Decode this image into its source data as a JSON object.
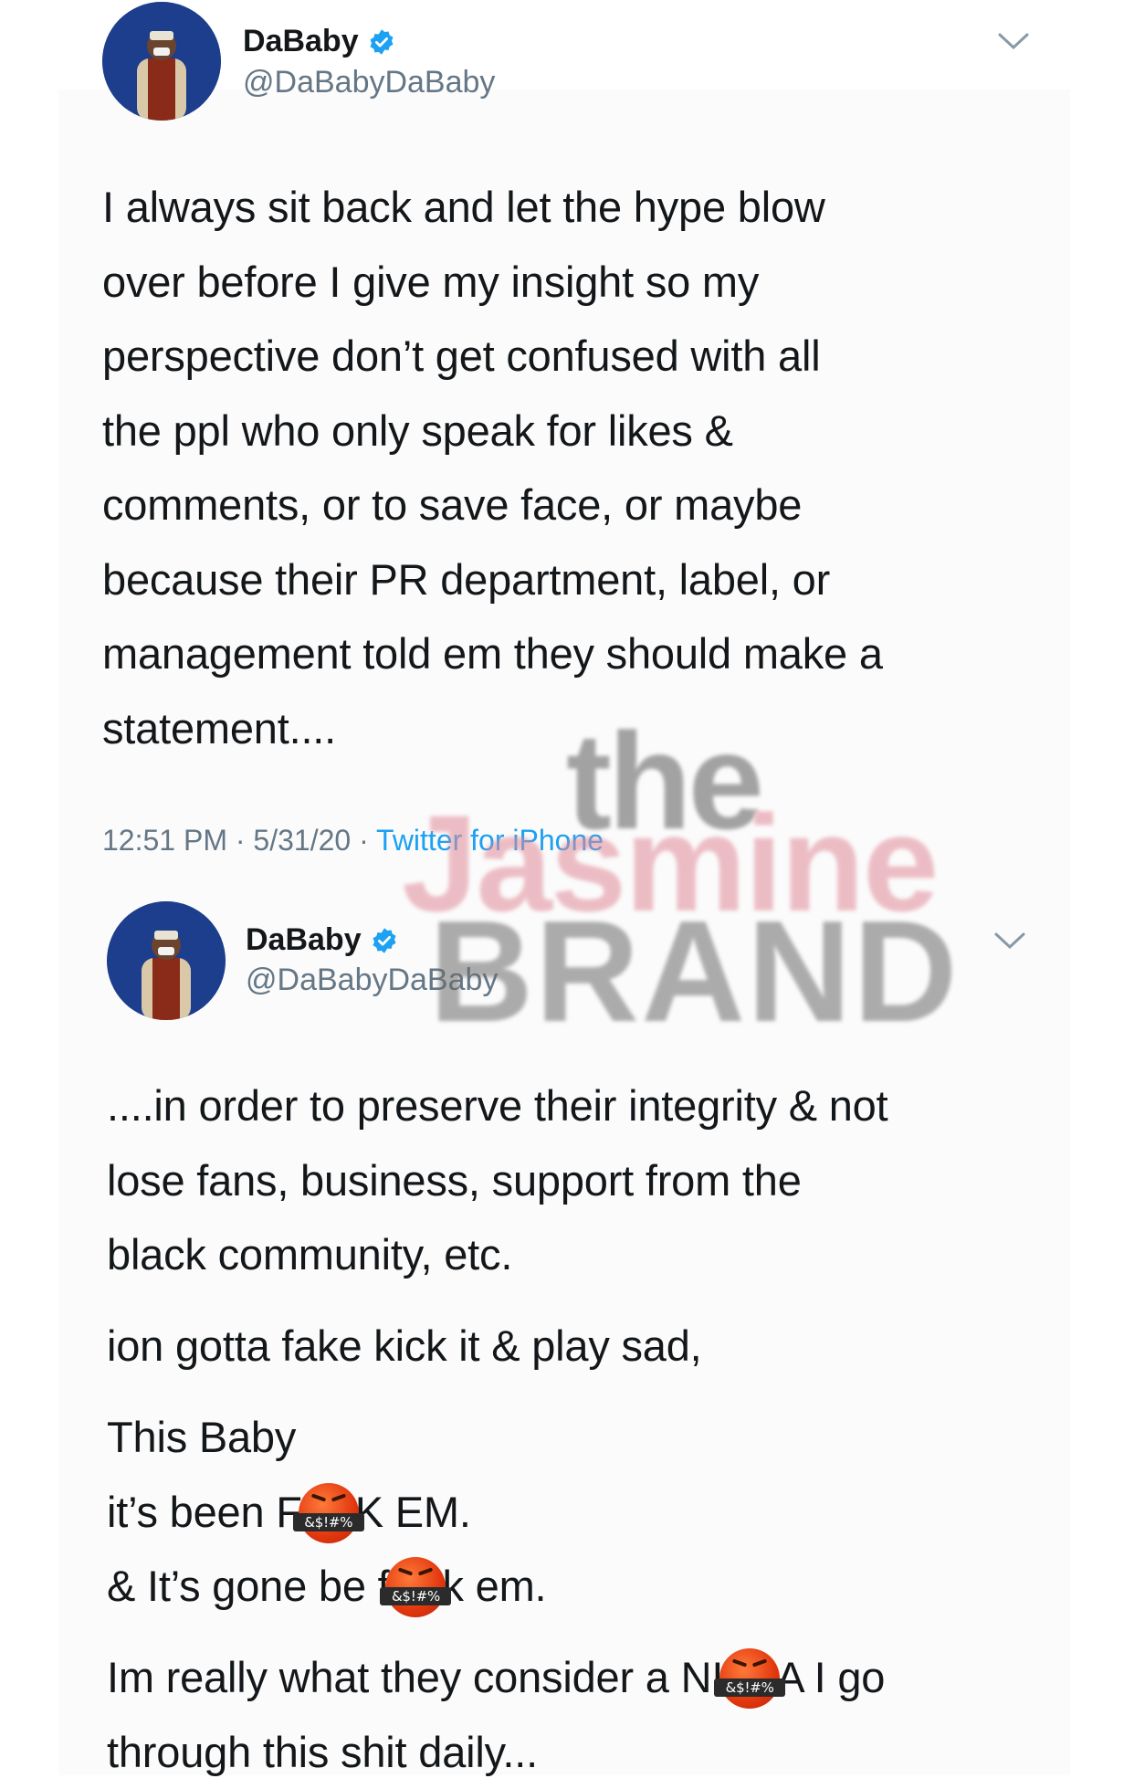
{
  "tweets": [
    {
      "author_name": "DaBaby",
      "handle": "@DaBabyDaBaby",
      "verified": true,
      "lines": [
        "I always sit back and let the hype blow",
        "over before I give my insight so my",
        "perspective don’t get confused with all",
        "the ppl who only speak for likes &",
        "comments, or to save face,  or maybe",
        "because their PR department, label, or",
        "management told em they should make a",
        "statement...."
      ],
      "time": "12:51 PM",
      "date": "5/31/20",
      "source": "Twitter for iPhone",
      "separator": " · "
    },
    {
      "author_name": "DaBaby",
      "handle": "@DaBabyDaBaby",
      "verified": true,
      "lines": [
        "....in order to preserve their integrity & not",
        "lose fans, business, support from the",
        "black community, etc."
      ],
      "line4": "ion gotta fake kick it & play sad,",
      "line5": "This Baby",
      "line6_pre": "it’s been F",
      "line6_post": "K EM.",
      "line7_pre": "& It’s gone be f",
      "line7_post": "k em.",
      "line8_pre": "Im really what they consider a NI",
      "line8_post": "A I go",
      "line9": "through this shit daily..."
    }
  ],
  "censor_emoji": {
    "name": "face-with-symbols-on-mouth",
    "symbols": "&$!#%"
  },
  "watermark": {
    "line1": "the",
    "line2": "Jasmine",
    "line3": "BRAND"
  },
  "colors": {
    "text": "#14171a",
    "secondary": "#657786",
    "link": "#1da1f2",
    "verified": "#1da1f2"
  }
}
